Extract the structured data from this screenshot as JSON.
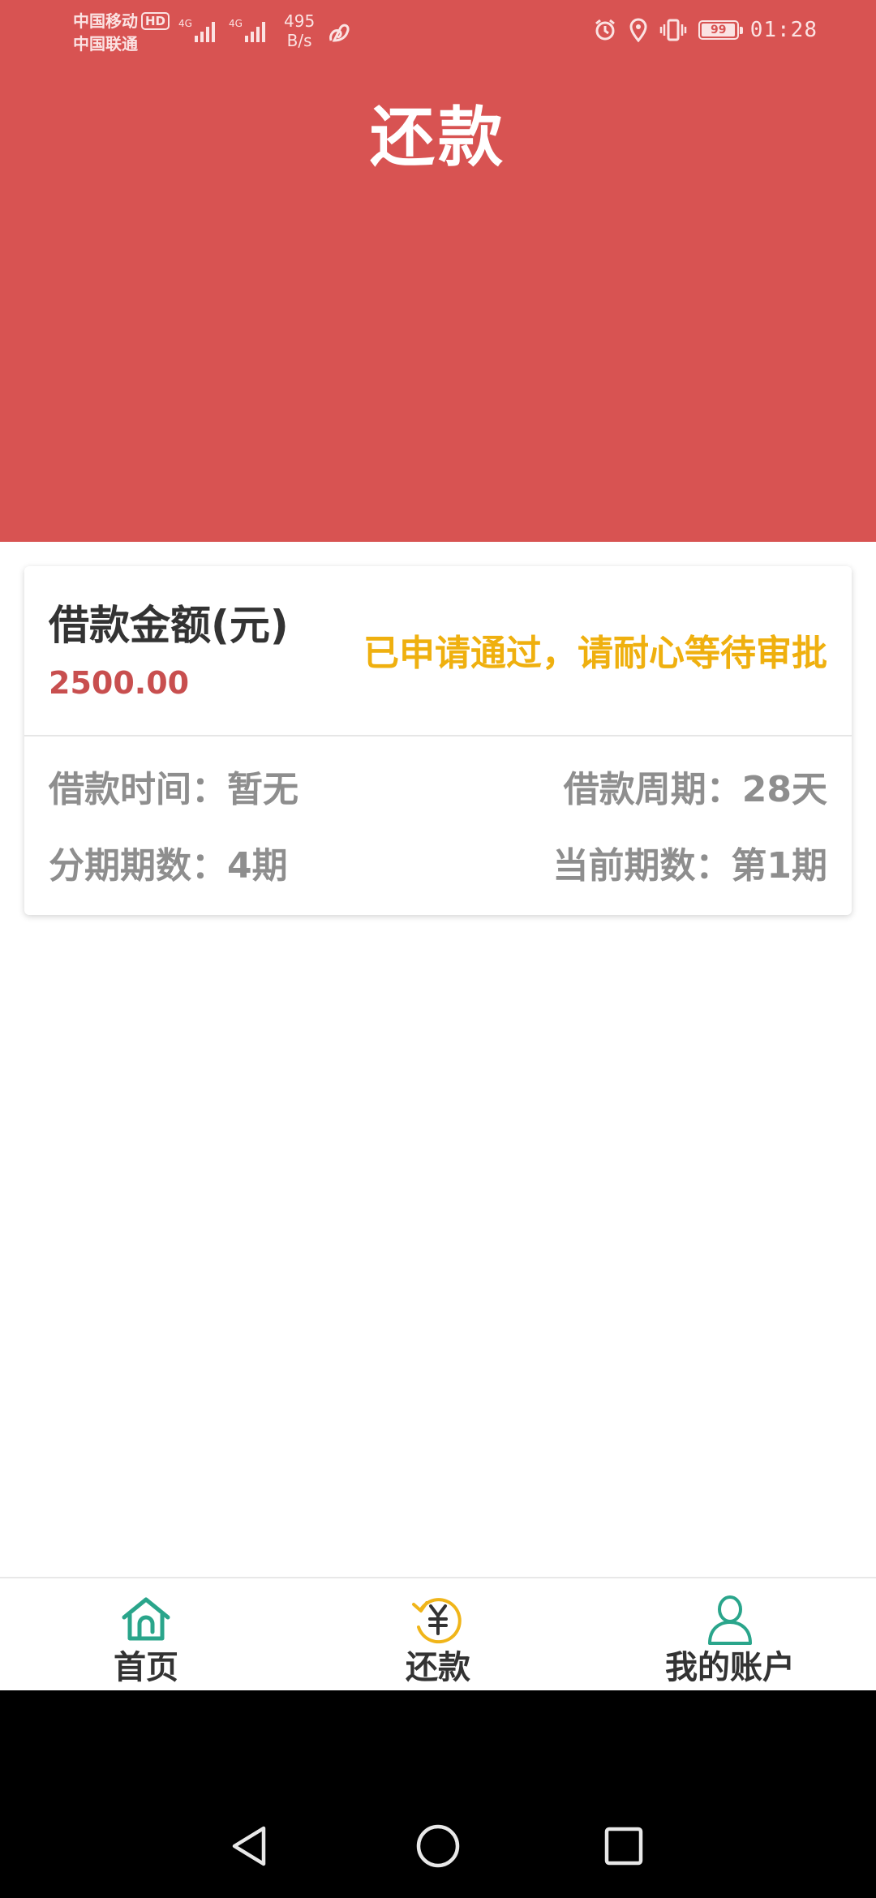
{
  "status_bar": {
    "carrier1": "中国移动",
    "carrier1_badge": "HD",
    "carrier2": "中国联通",
    "network1": "4G",
    "network2": "4G",
    "speed_value": "495",
    "speed_unit": "B/s",
    "battery": "99",
    "time": "01:28"
  },
  "header": {
    "title": "还款"
  },
  "loan_card": {
    "amount_label": "借款金额(元)",
    "amount_value": "2500.00",
    "status_message": "已申请通过，请耐心等待审批",
    "loan_time": "借款时间：暂无",
    "loan_period": "借款周期：28天",
    "installments": "分期期数：4期",
    "current_installment": "当前期数：第1期"
  },
  "bottom_nav": {
    "items": [
      {
        "label": "首页",
        "icon": "home-icon"
      },
      {
        "label": "还款",
        "icon": "repayment-icon"
      },
      {
        "label": "我的账户",
        "icon": "account-icon"
      }
    ],
    "active_index": 1
  },
  "colors": {
    "header_bg": "#d85352",
    "amount": "#c84f4f",
    "status": "#efb00f",
    "nav_green": "#2aa58b",
    "nav_active": "#f0b51a"
  }
}
